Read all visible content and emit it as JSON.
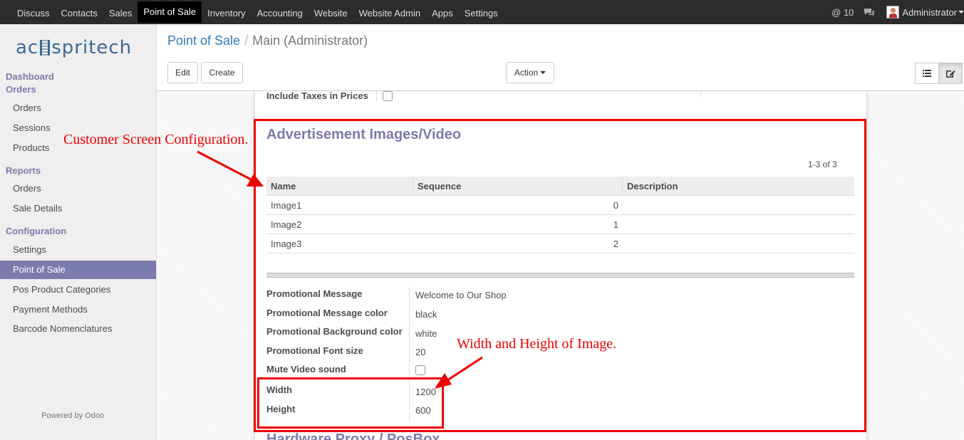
{
  "topnav": {
    "items": [
      "Discuss",
      "Contacts",
      "Sales",
      "Point of Sale",
      "Inventory",
      "Accounting",
      "Website",
      "Website Admin",
      "Apps",
      "Settings"
    ],
    "active_index": 3,
    "mentions": "@ 10",
    "user": "Administrator"
  },
  "sidebar": {
    "logo": {
      "pre": "ac",
      "post": "spritech"
    },
    "sections": [
      {
        "title": "Dashboard"
      },
      {
        "title": "Orders",
        "items": [
          "Orders",
          "Sessions",
          "Products"
        ]
      },
      {
        "title": "Reports",
        "items": [
          "Orders",
          "Sale Details"
        ]
      },
      {
        "title": "Configuration",
        "items": [
          "Settings",
          "Point of Sale",
          "Pos Product Categories",
          "Payment Methods",
          "Barcode Nomenclatures"
        ]
      }
    ],
    "active_item": "Point of Sale",
    "footer": "Powered by Odoo"
  },
  "control_panel": {
    "breadcrumb": {
      "parent": "Point of Sale",
      "separator": "/",
      "current": "Main (Administrator)"
    },
    "edit_label": "Edit",
    "create_label": "Create",
    "action_label": "Action"
  },
  "form": {
    "include_taxes_label": "Include Taxes in Prices",
    "ad_section_title": "Advertisement Images/Video",
    "pager": "1-3 of 3",
    "columns": [
      "Name",
      "Sequence",
      "Description"
    ],
    "rows": [
      {
        "name": "Image1",
        "sequence": "0",
        "description": ""
      },
      {
        "name": "Image2",
        "sequence": "1",
        "description": ""
      },
      {
        "name": "Image3",
        "sequence": "2",
        "description": ""
      }
    ],
    "fields": {
      "promo_message": {
        "label": "Promotional Message",
        "value": "Welcome to Our Shop"
      },
      "promo_message_color": {
        "label": "Promotional Message color",
        "value": "black"
      },
      "promo_bg_color": {
        "label": "Promotional Background color",
        "value": "white"
      },
      "promo_font_size": {
        "label": "Promotional Font size",
        "value": "20"
      },
      "mute_video": {
        "label": "Mute Video sound",
        "value": false
      },
      "width": {
        "label": "Width",
        "value": "1200"
      },
      "height": {
        "label": "Height",
        "value": "600"
      }
    },
    "next_section_title": "Hardware Proxy / PosBox"
  },
  "annotations": {
    "customer_screen": "Customer Screen Configuration.",
    "width_height": "Width and Height of Image.",
    "color": "#e00000"
  }
}
